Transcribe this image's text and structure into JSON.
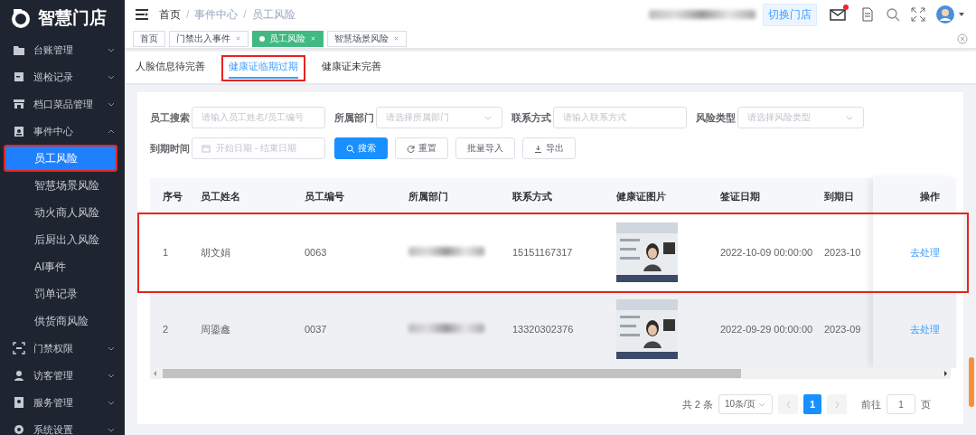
{
  "app": {
    "logo_text": "智慧门店"
  },
  "sidebar": {
    "items": [
      {
        "label": "台账管理",
        "expanded": false
      },
      {
        "label": "巡检记录",
        "expanded": false
      },
      {
        "label": "档口菜品管理",
        "expanded": false
      },
      {
        "label": "事件中心",
        "expanded": true,
        "children": [
          {
            "label": "员工风险",
            "selected": true,
            "annotated": true
          },
          {
            "label": "智慧场景风险",
            "selected": false,
            "annotated": false
          },
          {
            "label": "动火商人风险",
            "selected": false,
            "annotated": false
          },
          {
            "label": "后厨出入风险",
            "selected": false,
            "annotated": false
          },
          {
            "label": "AI事件",
            "selected": false,
            "annotated": false
          },
          {
            "label": "罚单记录",
            "selected": false,
            "annotated": false
          },
          {
            "label": "供货商风险",
            "selected": false,
            "annotated": false
          }
        ]
      },
      {
        "label": "门禁权限",
        "expanded": false
      },
      {
        "label": "访客管理",
        "expanded": false
      },
      {
        "label": "服务管理",
        "expanded": false
      },
      {
        "label": "系统设置",
        "expanded": false
      }
    ]
  },
  "header": {
    "breadcrumb": [
      "首页",
      "事件中心",
      "员工风险"
    ],
    "breadcrumb_separator": "/",
    "user_redacted": true,
    "switch_store": "切换门店",
    "mail_unread": true
  },
  "tabs": [
    {
      "label": "首页",
      "selected": false,
      "closable": false
    },
    {
      "label": "门禁出入事件",
      "selected": false,
      "closable": true
    },
    {
      "label": "员工风险",
      "selected": true,
      "closable": true
    },
    {
      "label": "智慧场景风险",
      "selected": false,
      "closable": true
    }
  ],
  "subtabs": [
    {
      "label": "人脸信息待完善",
      "selected": false,
      "annotated": false
    },
    {
      "label": "健康证临期过期",
      "selected": true,
      "annotated": true
    },
    {
      "label": "健康证未完善",
      "selected": false,
      "annotated": false
    }
  ],
  "filters": [
    {
      "label": "员工搜索",
      "kind": "input",
      "placeholder": "请输入员工姓名/员工编号"
    },
    {
      "label": "所属部门",
      "kind": "select",
      "placeholder": "请选择所属部门"
    },
    {
      "label": "联系方式",
      "kind": "input",
      "placeholder": "请输入联系方式"
    },
    {
      "label": "风险类型",
      "kind": "select",
      "placeholder": "请选择风险类型"
    },
    {
      "label": "到期时间",
      "kind": "daterange",
      "start_placeholder": "开始日期",
      "separator": "-",
      "end_placeholder": "结束日期"
    }
  ],
  "buttons": [
    {
      "label": "搜索",
      "kind": "search"
    },
    {
      "label": "重置",
      "kind": "reset"
    },
    {
      "label": "批量导入",
      "kind": "plain"
    },
    {
      "label": "导出",
      "kind": "export"
    }
  ],
  "table": {
    "columns": [
      "序号",
      "员工姓名",
      "员工编号",
      "所属部门",
      "联系方式",
      "健康证图片",
      "签证日期",
      "到期日"
    ],
    "action_column": "操作",
    "rows": [
      {
        "index": "1",
        "name": "胡文娟",
        "id": "0063",
        "department_redacted": true,
        "phone": "15151167317",
        "issue_date": "2022-10-09 00:00:00",
        "expiry_date": "2023-10",
        "action": "去处理",
        "hovered": false,
        "annotated": true
      },
      {
        "index": "2",
        "name": "周鎏鑫",
        "id": "0037",
        "department_redacted": true,
        "phone": "13320302376",
        "issue_date": "2022-09-29 00:00:00",
        "expiry_date": "2023-09",
        "action": "去处理",
        "hovered": true,
        "annotated": false
      }
    ]
  },
  "pagination": {
    "total": "共 2 条",
    "page_size": "10条/页",
    "pages": [
      {
        "label": "1",
        "selected": true
      }
    ],
    "goto_label": "前往",
    "goto_value": "1",
    "page_suffix": "页"
  }
}
